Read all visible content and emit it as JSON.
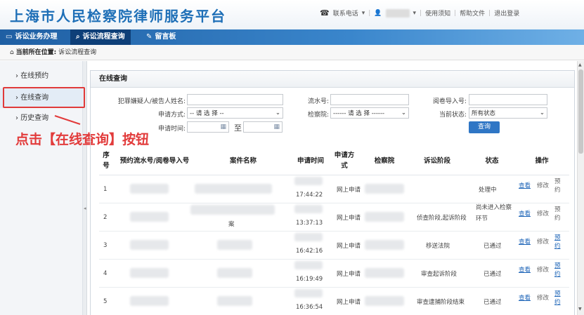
{
  "header": {
    "logo": "上海市人民检察院律师服务平台",
    "phone_label": "联系电话",
    "links": [
      "使用须知",
      "帮助文件",
      "退出登录"
    ]
  },
  "nav": {
    "items": [
      {
        "label": "诉讼业务办理",
        "icon": "monitor-icon"
      },
      {
        "label": "诉讼流程查询",
        "icon": "search-icon"
      },
      {
        "label": "留言板",
        "icon": "pen-icon"
      }
    ]
  },
  "breadcrumb": {
    "prefix": "当前所在位置:",
    "path": "诉讼流程查询"
  },
  "sidebar": {
    "items": [
      {
        "label": "在线预约"
      },
      {
        "label": "在线查询"
      },
      {
        "label": "历史查询"
      }
    ]
  },
  "annotation": "点击【在线查询】按钮",
  "panel": {
    "title": "在线查询",
    "form": {
      "suspect_label": "犯罪嫌疑人/被告人姓名:",
      "serial_label": "流水号:",
      "file_label": "阅卷导入号:",
      "method_label": "申请方式:",
      "method_value": "-- 请 选 择 --",
      "procuratorate_label": "检察院:",
      "procuratorate_value": "------ 请 选 择 ------",
      "status_label": "当前状态:",
      "status_value": "所有状态",
      "time_label": "申请时间:",
      "to_label": "至",
      "query_button": "查询"
    },
    "table": {
      "headers": {
        "index": "序号",
        "serial": "预约流水号/阅卷导入号",
        "case_name": "案件名称",
        "apply_time": "申请时间",
        "apply_method": "申请方式",
        "procuratorate": "检察院",
        "stage": "诉讼阶段",
        "status": "状态",
        "actions": "操作"
      },
      "rows": [
        {
          "index": "1",
          "case_name": "",
          "time": "17:44:22",
          "method": "网上申请",
          "stage": "",
          "status": "处理中",
          "view": "查看",
          "edit": "修改",
          "book": "预约"
        },
        {
          "index": "2",
          "case_name": "案",
          "time": "13:37:13",
          "method": "网上申请",
          "stage": "侦查阶段,起诉阶段",
          "status": "尚未进入检察环节",
          "view": "查看",
          "edit": "修改",
          "book": "预约"
        },
        {
          "index": "3",
          "case_name": "",
          "time": "16:42:16",
          "method": "网上申请",
          "stage": "移送法院",
          "status": "已通过",
          "view": "查看",
          "edit": "修改",
          "book": "预约"
        },
        {
          "index": "4",
          "case_name": "",
          "time": "16:19:49",
          "method": "网上申请",
          "stage": "审查起诉阶段",
          "status": "已通过",
          "view": "查看",
          "edit": "修改",
          "book": "预约"
        },
        {
          "index": "5",
          "case_name": "",
          "time": "16:36:54",
          "method": "网上申请",
          "stage": "审查逮捕阶段结束",
          "status": "已通过",
          "view": "查看",
          "edit": "修改",
          "book": "预约"
        }
      ]
    }
  },
  "colors": {
    "brand": "#1e6fb7",
    "nav_active": "#0e3f78",
    "highlight": "#e03a3a",
    "link": "#1f66b8"
  }
}
